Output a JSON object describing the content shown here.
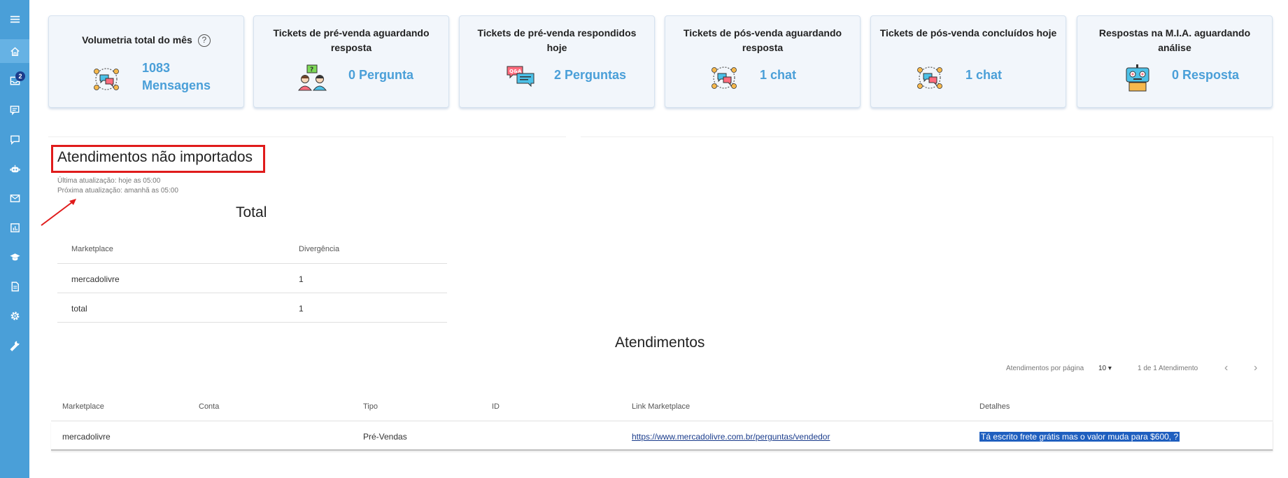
{
  "sidebar": {
    "badge_count": "2",
    "items": [
      "menu-icon",
      "home-icon",
      "inbox-icon",
      "chat-list-icon",
      "message-icon",
      "robot-icon",
      "mail-icon",
      "report-icon",
      "graduation-cap-icon",
      "document-icon",
      "settings-icon",
      "wrench-icon"
    ]
  },
  "cards": [
    {
      "title": "Volumetria total do mês",
      "help": "?",
      "value": "1083 Mensagens"
    },
    {
      "title": "Tickets de pré-venda aguardando resposta",
      "value": "0 Pergunta"
    },
    {
      "title": "Tickets de pré-venda respondidos hoje",
      "value": "2 Perguntas"
    },
    {
      "title": "Tickets de pós-venda aguardando resposta",
      "value": "1 chat"
    },
    {
      "title": "Tickets de pós-venda concluídos hoje",
      "value": "1 chat"
    },
    {
      "title": "Respostas na M.I.A. aguardando análise",
      "value": "0 Resposta"
    }
  ],
  "section": {
    "title": "Atendimentos não importados",
    "last_update": "Última atualização: hoje as 05:00",
    "next_update": "Próxima atualização: amanhã as 05:00"
  },
  "total_table": {
    "title": "Total",
    "headers": [
      "Marketplace",
      "Divergência"
    ],
    "rows": [
      [
        "mercadolivre",
        "1"
      ],
      [
        "total",
        "1"
      ]
    ]
  },
  "atendimentos": {
    "title": "Atendimentos",
    "per_page_label": "Atendimentos por página",
    "per_page_value": "10",
    "range": "1 de 1 Atendimento",
    "headers": [
      "Marketplace",
      "Conta",
      "Tipo",
      "ID",
      "Link Marketplace",
      "Detalhes"
    ],
    "rows": [
      {
        "marketplace": "mercadolivre",
        "conta": "",
        "tipo": "Pré-Vendas",
        "id": "",
        "link": "https://www.mercadolivre.com.br/perguntas/vendedor",
        "detalhes": "Tá escrito frete grátis mas o valor muda para $600, ?"
      }
    ]
  },
  "colors": {
    "sidebar": "#4a9fd8",
    "accent": "#4a9fd8",
    "highlight_box": "#e01b1b"
  }
}
